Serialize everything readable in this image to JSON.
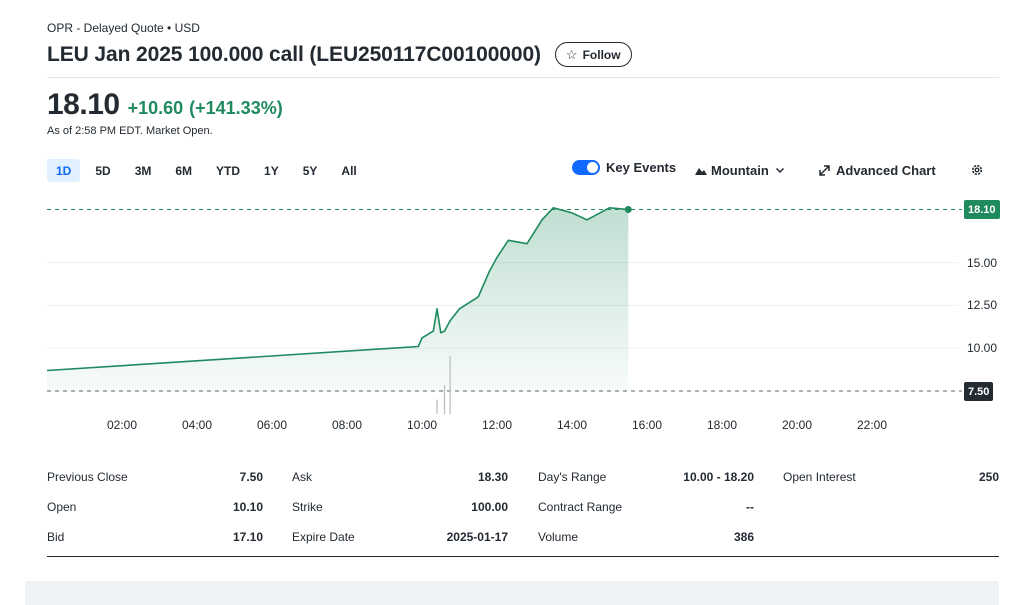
{
  "header": {
    "quote_source": "OPR - Delayed Quote • USD",
    "title": "LEU Jan 2025 100.000 call (LEU250117C00100000)",
    "follow_label": "Follow"
  },
  "price": {
    "last": "18.10",
    "change": "+10.60",
    "change_pct": "(+141.33%)",
    "as_of": "As of 2:58 PM EDT. Market Open."
  },
  "range_tabs": [
    "1D",
    "5D",
    "3M",
    "6M",
    "YTD",
    "1Y",
    "5Y",
    "All"
  ],
  "active_range": "1D",
  "chart_tools": {
    "key_events_label": "Key Events",
    "key_events_on": true,
    "chart_type_label": "Mountain",
    "advanced_label": "Advanced Chart"
  },
  "colors": {
    "up": "#1e8a5e",
    "accent": "#0f69ff",
    "text": "#232a31"
  },
  "chart_data": {
    "type": "area",
    "x_tick_labels": [
      "02:00",
      "04:00",
      "06:00",
      "08:00",
      "10:00",
      "12:00",
      "14:00",
      "16:00",
      "18:00",
      "20:00",
      "22:00"
    ],
    "y_tick_labels": [
      "10.00",
      "12.50",
      "15.00"
    ],
    "ylim": [
      7.0,
      18.5
    ],
    "xlim_hours": [
      0.0,
      24.0
    ],
    "current_price_tag": "18.10",
    "previous_close_tag": "7.50",
    "series": [
      {
        "x_hours": [
          0.0,
          9.9,
          10.0,
          10.3,
          10.4,
          10.5,
          10.6,
          10.75,
          11.0,
          11.5,
          11.8,
          12.0,
          12.3,
          12.8,
          13.2,
          13.5,
          14.0,
          14.4,
          15.0,
          15.5
        ],
        "values": [
          8.7,
          10.1,
          10.6,
          11.0,
          12.3,
          10.9,
          11.0,
          11.6,
          12.3,
          13.0,
          14.5,
          15.3,
          16.3,
          16.1,
          17.5,
          18.2,
          17.9,
          17.5,
          18.2,
          18.1
        ]
      }
    ],
    "volume_bars_hours": [
      10.4,
      10.6,
      10.75
    ],
    "volume_values": [
      1,
      2,
      4
    ],
    "grid": true
  },
  "stats": {
    "col1": [
      {
        "label": "Previous Close",
        "value": "7.50"
      },
      {
        "label": "Open",
        "value": "10.10"
      },
      {
        "label": "Bid",
        "value": "17.10"
      }
    ],
    "col2": [
      {
        "label": "Ask",
        "value": "18.30"
      },
      {
        "label": "Strike",
        "value": "100.00"
      },
      {
        "label": "Expire Date",
        "value": "2025-01-17"
      }
    ],
    "col3": [
      {
        "label": "Day's Range",
        "value": "10.00 - 18.20"
      },
      {
        "label": "Contract Range",
        "value": "--"
      },
      {
        "label": "Volume",
        "value": "386"
      }
    ],
    "col4": [
      {
        "label": "Open Interest",
        "value": "250"
      }
    ]
  }
}
